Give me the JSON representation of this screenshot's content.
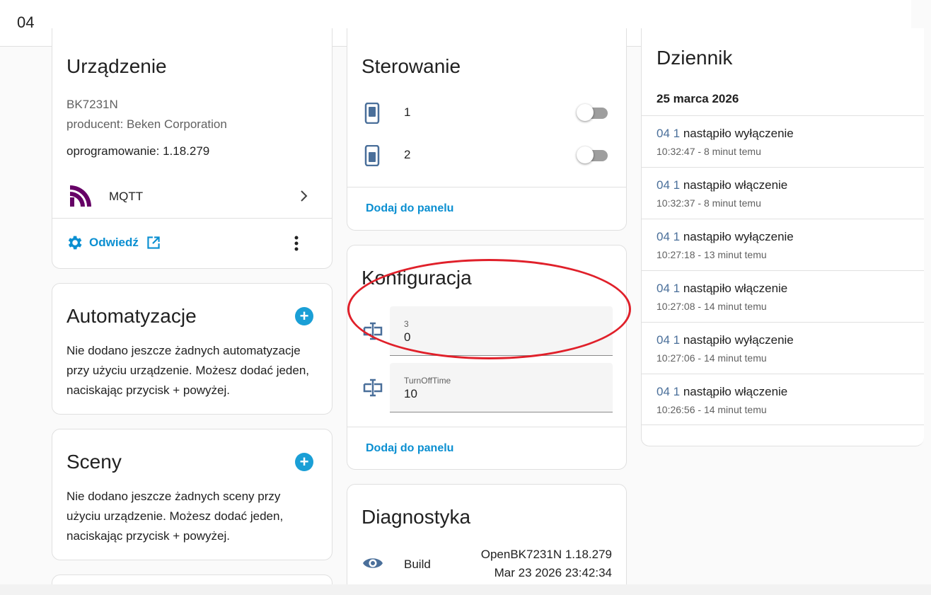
{
  "header": {
    "title": "04"
  },
  "device": {
    "title": "Urządzenie",
    "model": "BK7231N",
    "manufacturer": "producent: Beken Corporation",
    "firmware": "oprogramowanie: 1.18.279",
    "integration": "MQTT",
    "visit_label": "Odwiedź"
  },
  "automations": {
    "title": "Automatyzacje",
    "text": [
      "Nie dodano jeszcze żadnych automatyzacje",
      "przy użyciu urządzenie. Możesz dodać jeden,",
      "naciskając przycisk + powyżej."
    ],
    "add_label": "+"
  },
  "scenes": {
    "title": "Sceny",
    "text": [
      "Nie dodano jeszcze żadnych sceny przy",
      "użyciu urządzenie. Możesz dodać jeden,",
      "naciskając przycisk + powyżej."
    ],
    "add_label": "+"
  },
  "controls": {
    "title": "Sterowanie",
    "items": [
      {
        "label": "1",
        "state": "off"
      },
      {
        "label": "2",
        "state": "off"
      }
    ],
    "add_to_panel": "Dodaj do panelu"
  },
  "config": {
    "title": "Konfiguracja",
    "fields": [
      {
        "label": "3",
        "value": "0"
      },
      {
        "label": "TurnOffTime",
        "value": "10"
      }
    ],
    "add_to_panel": "Dodaj do panelu"
  },
  "diagnostics": {
    "title": "Diagnostyka",
    "build_label": "Build",
    "build_value_1": "OpenBK7231N 1.18.279",
    "build_value_2": "Mar 23 2026 23:42:34"
  },
  "logbook": {
    "title": "Dziennik",
    "date": "25 marca 2026",
    "entries": [
      {
        "entity": "04 1",
        "action": "nastąpiło wyłączenie",
        "time": "10:32:47 - 8 minut temu"
      },
      {
        "entity": "04 1",
        "action": "nastąpiło włączenie",
        "time": "10:32:37 - 8 minut temu"
      },
      {
        "entity": "04 1",
        "action": "nastąpiło wyłączenie",
        "time": "10:27:18 - 13 minut temu"
      },
      {
        "entity": "04 1",
        "action": "nastąpiło włączenie",
        "time": "10:27:08 - 14 minut temu"
      },
      {
        "entity": "04 1",
        "action": "nastąpiło wyłączenie",
        "time": "10:27:06 - 14 minut temu"
      },
      {
        "entity": "04 1",
        "action": "nastąpiło włączenie",
        "time": "10:26:56 - 14 minut temu"
      }
    ]
  },
  "colors": {
    "accent": "#0a8fd1",
    "entity_icon": "#4a6f9a",
    "mqtt": "#660066",
    "highlight": "#e0202a"
  }
}
